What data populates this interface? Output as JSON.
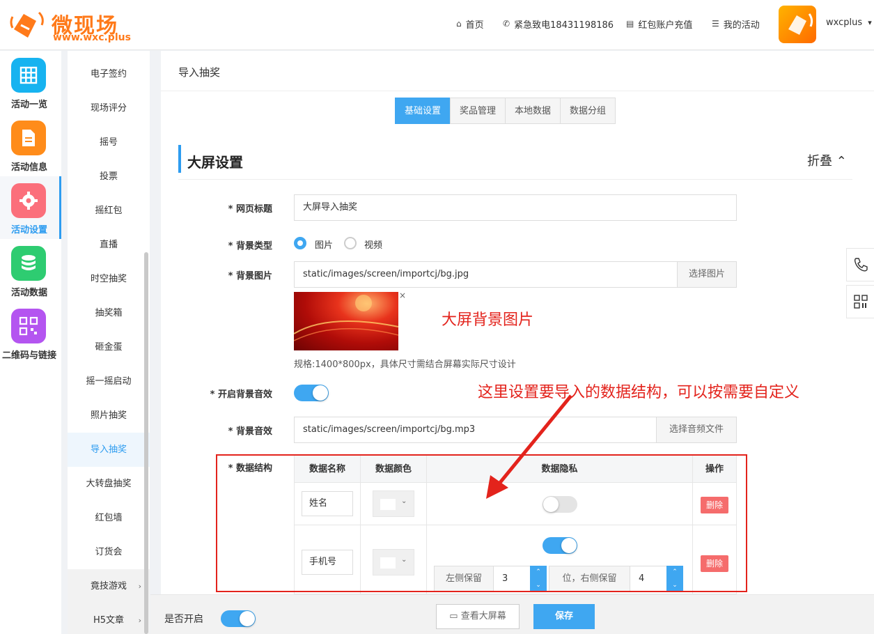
{
  "header": {
    "logo_text": "微现场",
    "logo_url": "www.wxc.plus",
    "nav": [
      {
        "icon": "home-icon",
        "glyph": "⌂",
        "label": "首页"
      },
      {
        "icon": "phone-icon",
        "glyph": "✆",
        "label": "紧急致电18431198186"
      },
      {
        "icon": "wallet-icon",
        "glyph": "▤",
        "label": "红包账户充值"
      },
      {
        "icon": "list-icon",
        "glyph": "☰",
        "label": "我的活动"
      }
    ],
    "user": "wxcplus",
    "user_caret": "▾"
  },
  "icon_nav": [
    {
      "label": "活动一览",
      "color": "#17b3f0",
      "icon": "grid-icon"
    },
    {
      "label": "活动信息",
      "color": "#ff8c1a",
      "icon": "document-icon"
    },
    {
      "label": "活动设置",
      "color": "#fb6f7b",
      "icon": "gear-icon"
    },
    {
      "label": "活动数据",
      "color": "#2ecc71",
      "icon": "database-icon"
    },
    {
      "label": "二维码与链接",
      "color": "#b455f0",
      "icon": "qrcode-icon"
    }
  ],
  "sub_nav": [
    "电子签约",
    "现场评分",
    "摇号",
    "投票",
    "摇红包",
    "直播",
    "时空抽奖",
    "抽奖箱",
    "砸金蛋",
    "摇一摇启动",
    "照片抽奖",
    "导入抽奖",
    "大转盘抽奖",
    "红包墙",
    "订货会",
    "竟技游戏",
    "H5文章"
  ],
  "sub_nav_arrow": "›",
  "breadcrumb": "导入抽奖",
  "tabs": [
    "基础设置",
    "奖品管理",
    "本地数据",
    "数据分组"
  ],
  "section": {
    "title": "大屏设置",
    "collapse": "折叠 ⌃"
  },
  "form": {
    "page_title_label": "* 网页标题",
    "page_title_value": "大屏导入抽奖",
    "bg_type_label": "* 背景类型",
    "bg_type_options": [
      "图片",
      "视频"
    ],
    "bg_image_label": "* 背景图片",
    "bg_image_value": "static/images/screen/importcj/bg.jpg",
    "bg_image_btn": "选择图片",
    "bg_image_close": "×",
    "bg_annotation": "大屏背景图片",
    "bg_hint": "规格:1400*800px，具体尺寸需结合屏幕实际尺寸设计",
    "bg_sound_toggle_label": "* 开启背景音效",
    "bg_sound_label": "* 背景音效",
    "bg_sound_value": "static/images/screen/importcj/bg.mp3",
    "bg_sound_btn": "选择音频文件",
    "data_struct_label": "* 数据结构",
    "annotation_struct": "这里设置要导入的数据结构，可以按需要自定义"
  },
  "table": {
    "headers": [
      "数据名称",
      "数据颜色",
      "数据隐私",
      "操作"
    ],
    "rows": [
      {
        "name": "姓名",
        "delete": "删除"
      },
      {
        "name": "手机号",
        "delete": "删除",
        "left_label": "左侧保留",
        "left_value": "3",
        "mid_label": "位，右侧保留",
        "right_value": "4",
        "spin_up": "⌃",
        "spin_down": "⌄"
      }
    ]
  },
  "footer": {
    "enable_label": "是否开启",
    "preview_btn": "▭ 查看大屏幕",
    "save_btn": "保存"
  }
}
